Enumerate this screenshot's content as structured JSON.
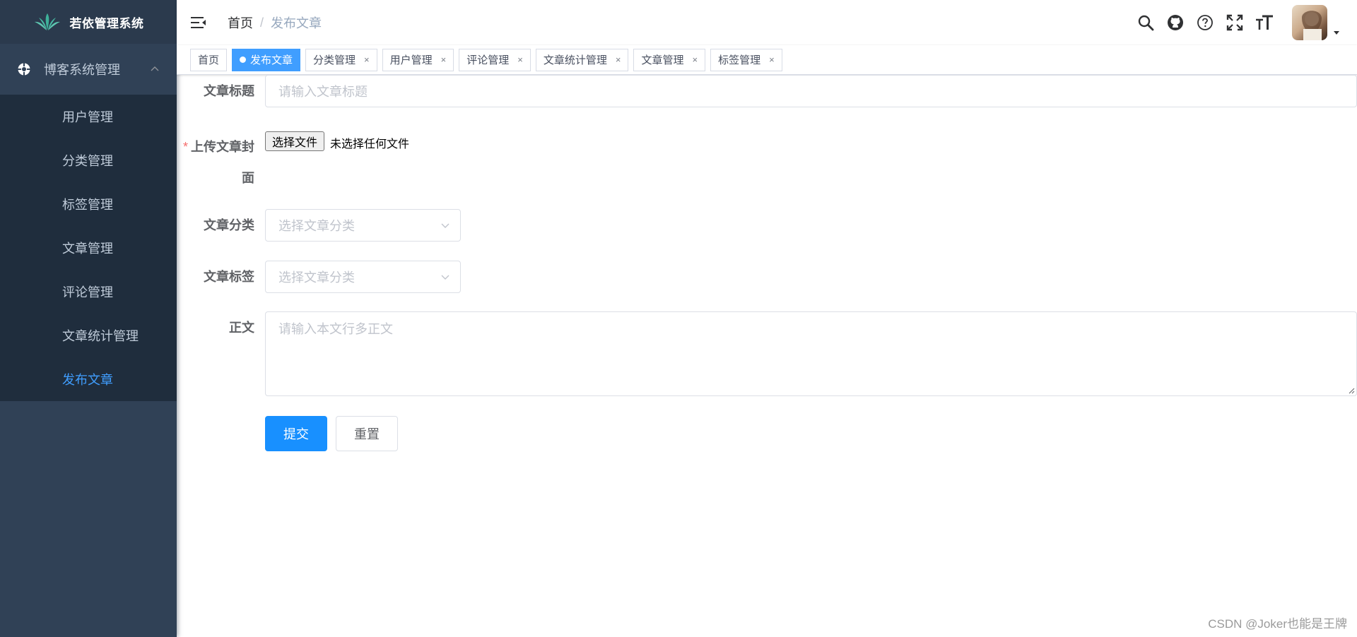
{
  "sidebar": {
    "logo_title": "若依管理系统",
    "menu_title": "博客系统管理",
    "items": [
      {
        "label": "用户管理",
        "active": false
      },
      {
        "label": "分类管理",
        "active": false
      },
      {
        "label": "标签管理",
        "active": false
      },
      {
        "label": "文章管理",
        "active": false
      },
      {
        "label": "评论管理",
        "active": false
      },
      {
        "label": "文章统计管理",
        "active": false
      },
      {
        "label": "发布文章",
        "active": true
      }
    ]
  },
  "navbar": {
    "breadcrumb_home": "首页",
    "breadcrumb_sep": "/",
    "breadcrumb_current": "发布文章",
    "icons": [
      "search-icon",
      "github-icon",
      "help-icon",
      "fullscreen-icon",
      "font-size-icon"
    ]
  },
  "tags": [
    {
      "label": "首页",
      "active": false,
      "closable": false
    },
    {
      "label": "发布文章",
      "active": true,
      "closable": false
    },
    {
      "label": "分类管理",
      "active": false,
      "closable": true
    },
    {
      "label": "用户管理",
      "active": false,
      "closable": true
    },
    {
      "label": "评论管理",
      "active": false,
      "closable": true
    },
    {
      "label": "文章统计管理",
      "active": false,
      "closable": true
    },
    {
      "label": "文章管理",
      "active": false,
      "closable": true
    },
    {
      "label": "标签管理",
      "active": false,
      "closable": true
    }
  ],
  "tag_close_glyph": "×",
  "form": {
    "title_label": "文章标题",
    "title_placeholder": "请输入文章标题",
    "cover_required": "*",
    "cover_label_line1": "上传文章封",
    "cover_label_line2": "面",
    "file_button": "选择文件",
    "file_none": "未选择任何文件",
    "category_label": "文章分类",
    "category_placeholder": "选择文章分类",
    "tag_label": "文章标签",
    "tag_placeholder": "选择文章分类",
    "body_label": "正文",
    "body_placeholder": "请输入本文行多正文",
    "submit": "提交",
    "reset": "重置"
  },
  "watermark": "CSDN @Joker也能是王牌",
  "colors": {
    "sidebar_bg": "#304156",
    "submenu_bg": "#1f2d3d",
    "accent": "#409eff",
    "primary_button": "#1890ff",
    "required": "#f56c6c"
  }
}
